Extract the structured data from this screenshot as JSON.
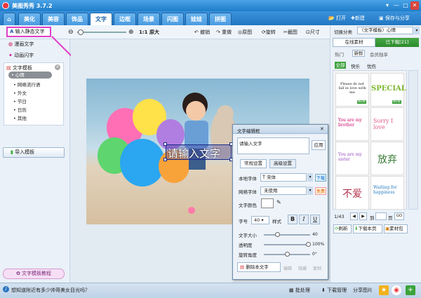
{
  "app": {
    "title": "美图秀秀 3.7.2"
  },
  "nav": {
    "tabs": [
      "美化",
      "美容",
      "饰品",
      "文字",
      "边框",
      "场景",
      "闪图",
      "娃娃",
      "拼图"
    ],
    "active_index": 3
  },
  "top_actions": {
    "open": "打开",
    "new": "新建",
    "save_share": "保存与分享"
  },
  "toolbar": {
    "original_size": "1:1 原大",
    "undo": "撤销",
    "redo": "重做",
    "original_image": "原图",
    "rotate": "旋转",
    "crop": "截图",
    "size": "尺寸"
  },
  "left": {
    "static_text": "输入静态文字",
    "comic_text": "漫画文字",
    "animated_text": "动画闪字",
    "template_title": "文字模板",
    "template_items": [
      "心情",
      "网络流行语",
      "外文",
      "节日",
      "日历",
      "其他"
    ],
    "import": "导入模板",
    "tutorial": "文字模板教程"
  },
  "canvas": {
    "overlay_text": "请输入文字"
  },
  "dialog": {
    "title": "文字编辑框",
    "input_value": "请输入文字",
    "apply": "应用",
    "tabs": [
      "常规设置",
      "高级设置"
    ],
    "local_font_label": "本地字体",
    "local_font_value": "宋体",
    "download": "下载",
    "web_font_label": "网络字体",
    "web_font_value": "未使用",
    "free": "免费",
    "color_label": "文字颜色",
    "size_label": "字号",
    "size_value": "40",
    "style_label": "样式",
    "bold": "B",
    "italic": "I",
    "underline": "U",
    "text_size_label": "文字大小",
    "text_size_value": "40",
    "opacity_label": "透明度",
    "opacity_value": "100%",
    "rotation_label": "旋转角度",
    "rotation_value": "0°",
    "delete": "删除本文字",
    "edit": "编辑",
    "hide": "隐藏",
    "copy": "复制"
  },
  "right": {
    "category_label": "切换分类",
    "category_value": "〈文字模板〉心情",
    "tab_online": "在线素材",
    "tab_downloaded": "已下载[21]",
    "sub_tabs": [
      "热门",
      "新鲜",
      "会员独享"
    ],
    "filters": [
      "全部",
      "快乐",
      "忧伤"
    ],
    "stickers": [
      "Please do not fall in love with me",
      "SPECIAL",
      "You are my brother",
      "Sorry I love",
      "You are my sister",
      "放弃",
      "不爱",
      "Waiting for happiness"
    ],
    "new_badge": "NEW",
    "page": "1/43",
    "page_unit": "页",
    "go": "GO",
    "refresh": "刷新",
    "download_page": "下载本页",
    "material_pack": "素材包"
  },
  "status": {
    "tip": "想知道附近有多少帅哥美女目光吗？",
    "batch": "批处理",
    "download_manager": "下载管理",
    "share_image": "分享图片"
  }
}
